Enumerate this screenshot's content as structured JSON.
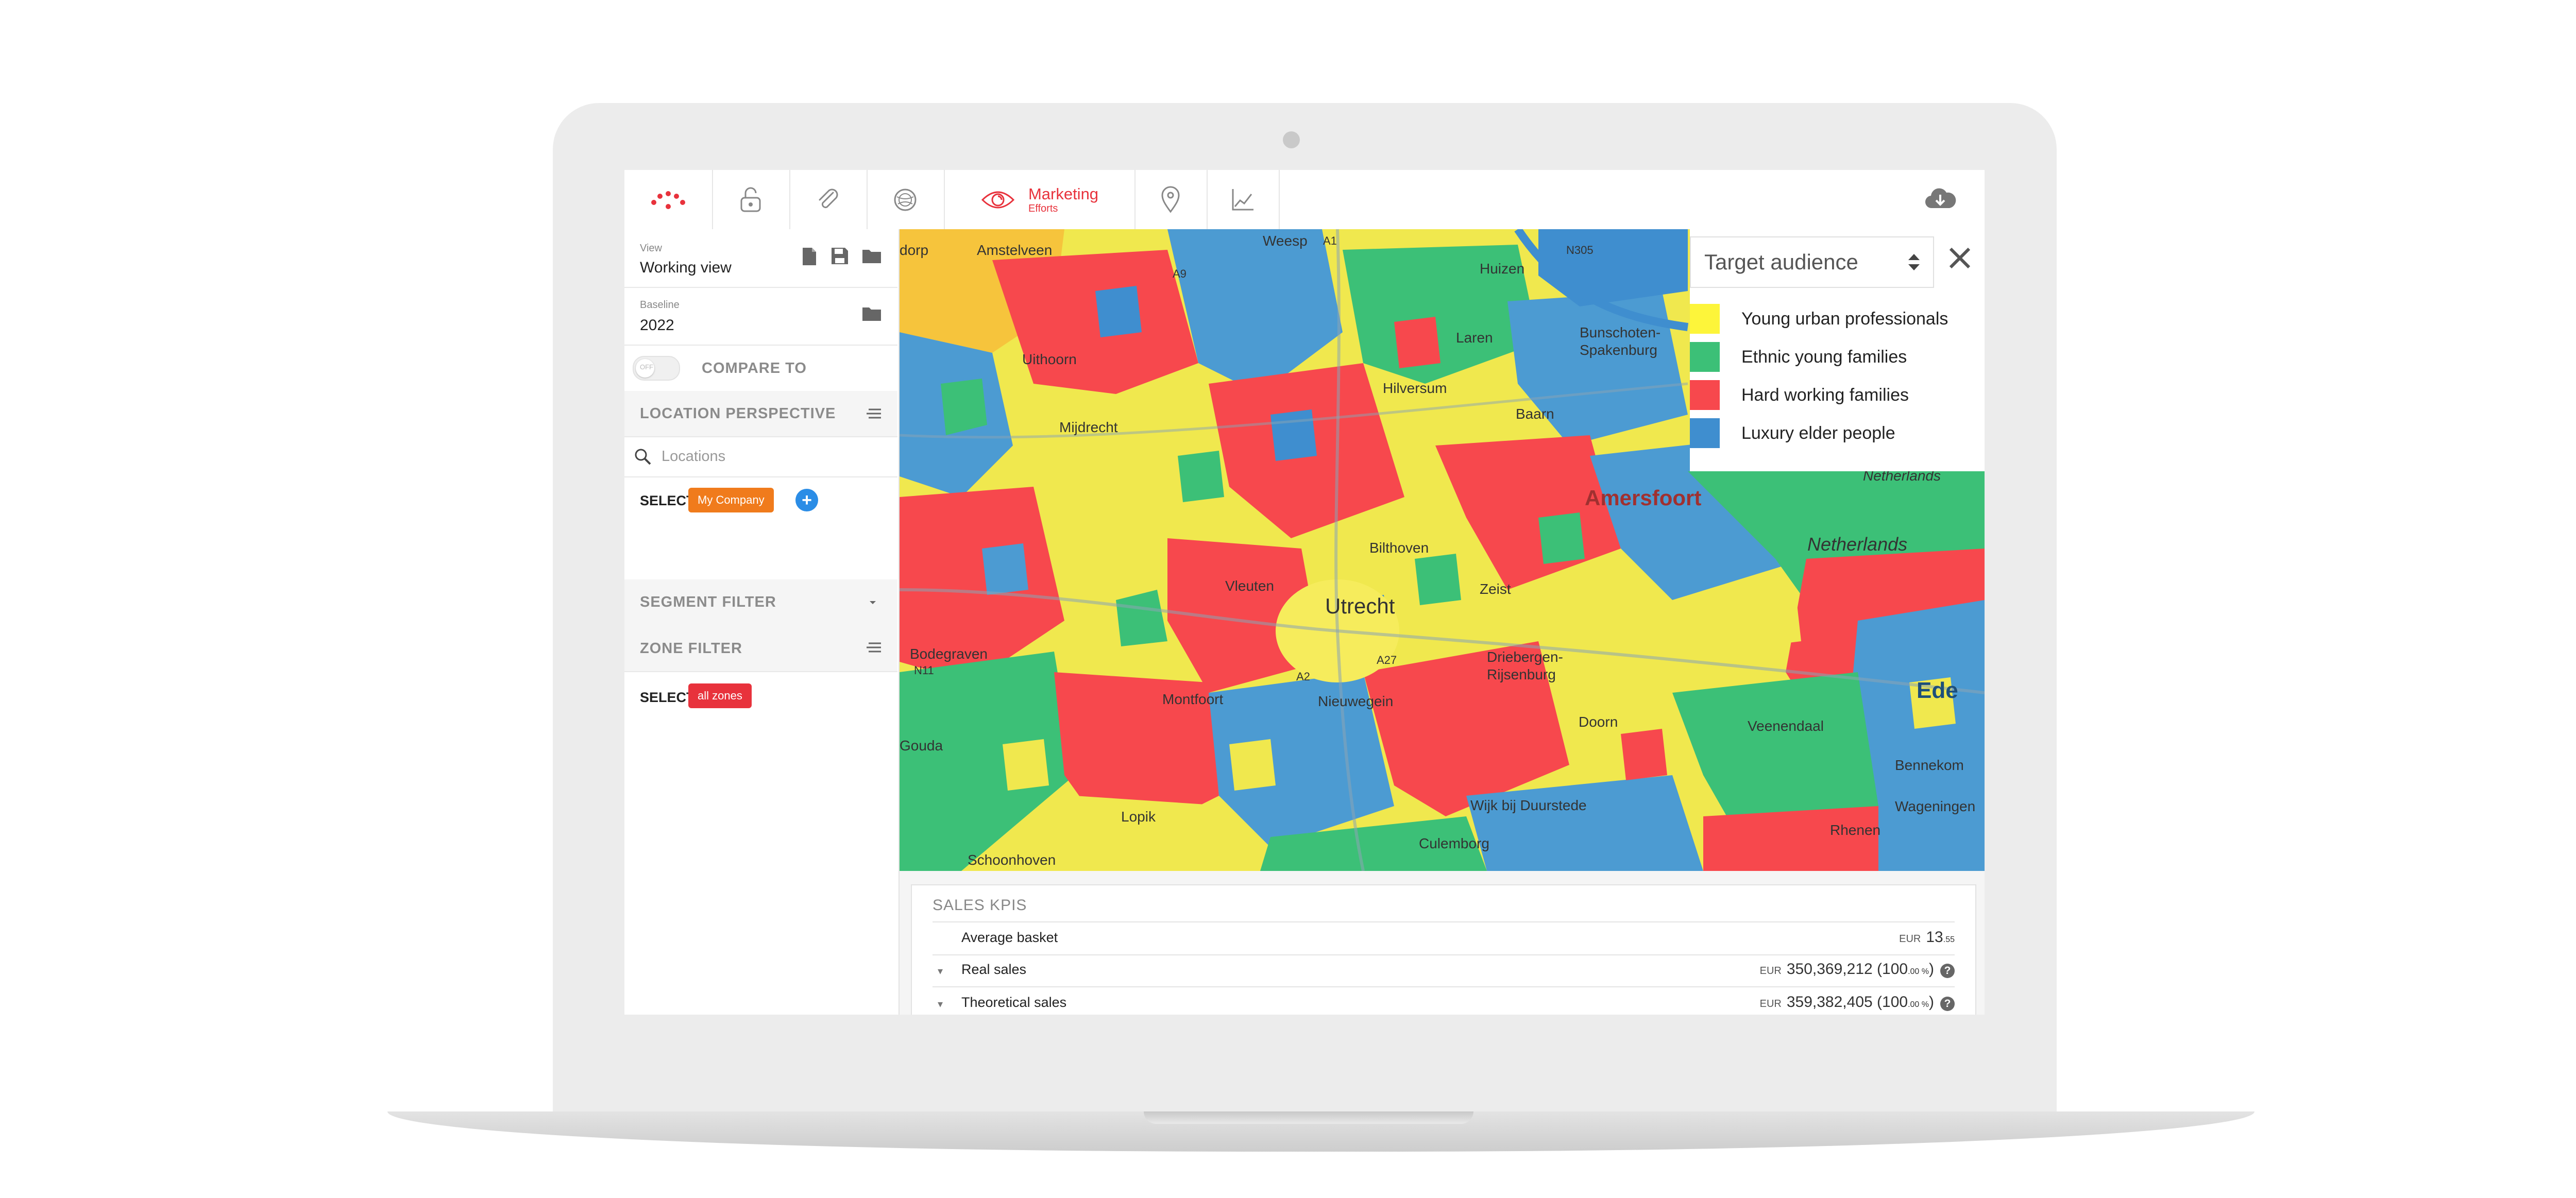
{
  "app": {
    "nav": {
      "active_label": "Marketing",
      "active_sublabel": "Efforts"
    }
  },
  "sidebar": {
    "view_label": "View",
    "view_value": "Working view",
    "baseline_label": "Baseline",
    "baseline_value": "2022",
    "toggle_state": "OFF",
    "compare_label": "COMPARE TO",
    "location_perspective_title": "LOCATION PERSPECTIVE",
    "search_placeholder": "Locations",
    "select_label": "SELECT",
    "company_chip": "My Company",
    "add_symbol": "+",
    "segment_filter_title": "SEGMENT FILTER",
    "zone_filter_title": "ZONE FILTER",
    "zone_select_label": "SELECT",
    "zone_chip": "all zones"
  },
  "map": {
    "panel_title": "Target audience",
    "legend": [
      {
        "label": "Young urban professionals",
        "color": "#fdf53a"
      },
      {
        "label": "Ethnic young families",
        "color": "#3cc077"
      },
      {
        "label": "Hard working families",
        "color": "#f7484d"
      },
      {
        "label": "Luxury elder people",
        "color": "#3f8ecf"
      }
    ],
    "places": {
      "amstelveen": "Amstelveen",
      "weesp": "Weesp",
      "huizen": "Huizen",
      "laren": "Laren",
      "hilversum": "Hilversum",
      "baarn": "Baarn",
      "bunschoten": "Bunschoten-",
      "spakenburg": "Spakenburg",
      "uithoorn": "Uithoorn",
      "mijdrecht": "Mijdrecht",
      "amersfoort": "Amersfoort",
      "netherlands1": "Netherlands",
      "netherlands2": "Netherlands",
      "bilthoven": "Bilthoven",
      "utrecht": "Utrecht",
      "vleuten": "Vleuten",
      "zeist": "Zeist",
      "driebergen": "Driebergen-",
      "rijsenburg": "Rijsenburg",
      "bodegraven": "Bodegraven",
      "montfoort": "Montfoort",
      "nieuwegein": "Nieuwegein",
      "doorn": "Doorn",
      "ede": "Ede",
      "veenendaal": "Veenendaal",
      "bennekom": "Bennekom",
      "wageningen": "Wageningen",
      "gouda": "Gouda",
      "lopik": "Lopik",
      "wijk": "Wijk bij Duurstede",
      "culemborg": "Culemborg",
      "rhenen": "Rhenen",
      "schoonhoven": "Schoonhoven",
      "road_a9": "A9",
      "road_a1": "A1",
      "road_n305": "N305",
      "road_a27": "A27",
      "road_n11": "N11",
      "road_a2": "A2",
      "place_dorp": "dorp"
    }
  },
  "kpis": {
    "title": "SALES KPIS",
    "rows": [
      {
        "name": "Average basket",
        "currency": "EUR",
        "value": "13",
        "sup": ".55",
        "extra": "",
        "help": ""
      },
      {
        "name": "Real sales",
        "currency": "EUR",
        "value": "350,369,212 (100",
        "sup": ".00 %",
        "extra": ")",
        "help": "?"
      },
      {
        "name": "Theoretical sales",
        "currency": "EUR",
        "value": "359,382,405 (100",
        "sup": ".00 %",
        "extra": ")",
        "help": "?"
      }
    ]
  }
}
